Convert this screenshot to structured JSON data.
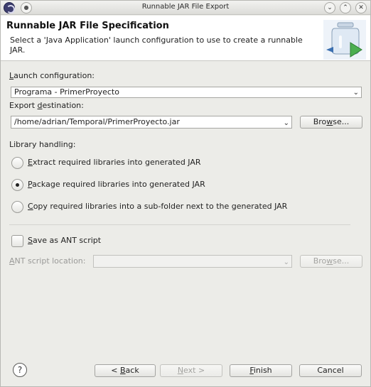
{
  "window": {
    "title": "Runnable JAR File Export"
  },
  "header": {
    "title": "Runnable JAR File Specification",
    "description": "Select a 'Java Application' launch configuration to use to create a runnable JAR."
  },
  "launch": {
    "label_pre": "",
    "label_key": "L",
    "label_post": "aunch configuration:",
    "value": "Programa - PrimerProyecto"
  },
  "export": {
    "label_pre": "Export ",
    "label_key": "d",
    "label_post": "estination:",
    "value": "/home/adrian/Temporal/PrimerProyecto.jar",
    "browse_pre": "Bro",
    "browse_key": "w",
    "browse_post": "se..."
  },
  "library": {
    "label": "Library handling:",
    "options": [
      {
        "pre": "",
        "key": "E",
        "post": "xtract required libraries into generated JAR",
        "checked": false
      },
      {
        "pre": "",
        "key": "P",
        "post": "ackage required libraries into generated JAR",
        "checked": true
      },
      {
        "pre": "",
        "key": "C",
        "post": "opy required libraries into a sub-folder next to the generated JAR",
        "checked": false
      }
    ]
  },
  "ant": {
    "checkbox_pre": "",
    "checkbox_key": "S",
    "checkbox_post": "ave as ANT script",
    "location_pre": "",
    "location_key": "A",
    "location_post": "NT script location:",
    "value": "",
    "browse_pre": "Bro",
    "browse_key": "w",
    "browse_post": "se..."
  },
  "footer": {
    "help": "?",
    "back_pre": "< ",
    "back_key": "B",
    "back_post": "ack",
    "next_pre": "",
    "next_key": "N",
    "next_post": "ext >",
    "finish_pre": "",
    "finish_key": "F",
    "finish_post": "inish",
    "cancel": "Cancel"
  },
  "icons": {
    "pin": "pin-icon",
    "minimize": "chevron-down-icon",
    "maximize": "chevron-up-icon",
    "close": "close-icon",
    "app": "eclipse-icon",
    "jar": "jar-export-icon",
    "help": "help-icon"
  }
}
